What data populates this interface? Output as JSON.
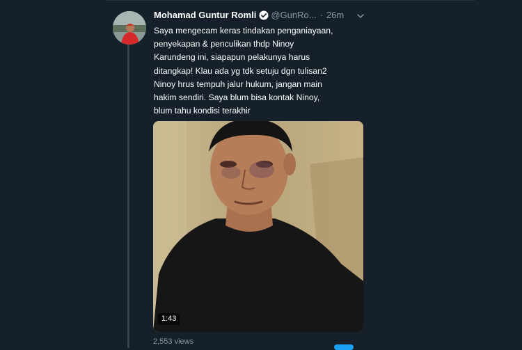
{
  "tweet": {
    "display_name": "Mohamad Guntur Romli",
    "handle": "@GunRo...",
    "separator": "·",
    "time": "26m",
    "text_lines": [
      "Saya mengecam keras tindakan penganiayaan,",
      "penyekapan & penculikan thdp Ninoy",
      "Karundeng ini, siapapun pelakunya harus",
      "ditangkap! Klau ada yg tdk setuju dgn tulisan2",
      "Ninoy hrus tempuh jalur hukum, jangan main",
      "hakim sendiri. Saya blum bisa kontak Ninoy,",
      "blum tahu kondisi terakhir"
    ],
    "video": {
      "duration": "1:43",
      "views": "2,553 views"
    }
  },
  "icons": {
    "verified": "verified-badge-icon",
    "caret": "chevron-down-icon"
  },
  "colors": {
    "background": "#15202b",
    "text_primary": "#ffffff",
    "text_secondary": "#8899a6",
    "accent": "#1da1f2",
    "thread_line": "#38444d"
  }
}
